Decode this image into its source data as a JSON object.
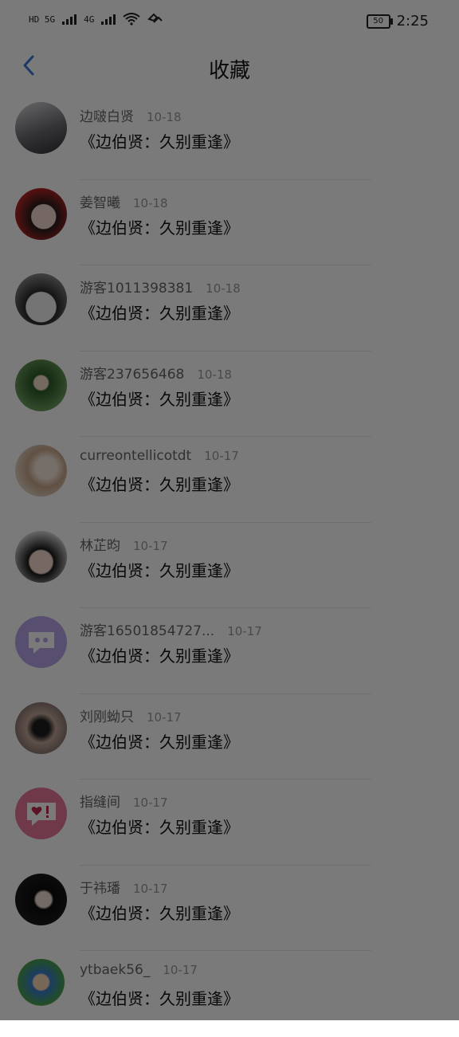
{
  "status_bar": {
    "network_left": "HD 5G",
    "network_right": "4G",
    "time": "2:25",
    "battery": "50"
  },
  "header": {
    "title": "收藏",
    "back_icon": "chevron-left-icon",
    "accent_color": "#3b78d8"
  },
  "favorites": [
    {
      "name": "边啵白贤",
      "date": "10-18",
      "title": "《边伯贤：久别重逢》"
    },
    {
      "name": "姜智曦",
      "date": "10-18",
      "title": "《边伯贤：久别重逢》"
    },
    {
      "name": "游客1011398381",
      "date": "10-18",
      "title": "《边伯贤：久别重逢》"
    },
    {
      "name": "游客237656468",
      "date": "10-18",
      "title": "《边伯贤：久别重逢》"
    },
    {
      "name": "curreontellicotdt",
      "date": "10-17",
      "title": "《边伯贤：久别重逢》"
    },
    {
      "name": "林芷昀",
      "date": "10-17",
      "title": "《边伯贤：久别重逢》"
    },
    {
      "name": "游客16501854727...",
      "date": "10-17",
      "title": "《边伯贤：久别重逢》"
    },
    {
      "name": "刘刚蚴只",
      "date": "10-17",
      "title": "《边伯贤：久别重逢》"
    },
    {
      "name": "指缝间",
      "date": "10-17",
      "title": "《边伯贤：久别重逢》"
    },
    {
      "name": "于祎璠",
      "date": "10-17",
      "title": "《边伯贤：久别重逢》"
    },
    {
      "name": "ytbaek56_",
      "date": "10-17",
      "title": "《边伯贤：久别重逢》"
    }
  ]
}
